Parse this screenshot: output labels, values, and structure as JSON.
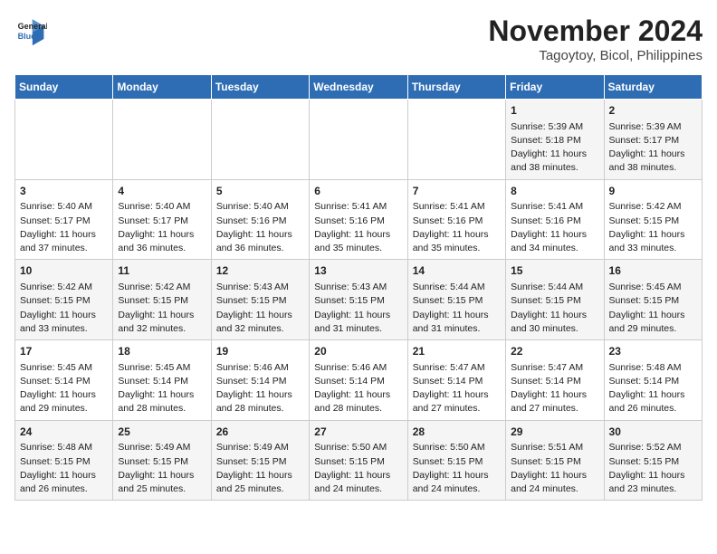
{
  "header": {
    "logo_line1": "General",
    "logo_line2": "Blue",
    "title": "November 2024",
    "subtitle": "Tagoytoy, Bicol, Philippines"
  },
  "days_of_week": [
    "Sunday",
    "Monday",
    "Tuesday",
    "Wednesday",
    "Thursday",
    "Friday",
    "Saturday"
  ],
  "weeks": [
    [
      {
        "day": "",
        "info": ""
      },
      {
        "day": "",
        "info": ""
      },
      {
        "day": "",
        "info": ""
      },
      {
        "day": "",
        "info": ""
      },
      {
        "day": "",
        "info": ""
      },
      {
        "day": "1",
        "info": "Sunrise: 5:39 AM\nSunset: 5:18 PM\nDaylight: 11 hours and 38 minutes."
      },
      {
        "day": "2",
        "info": "Sunrise: 5:39 AM\nSunset: 5:17 PM\nDaylight: 11 hours and 38 minutes."
      }
    ],
    [
      {
        "day": "3",
        "info": "Sunrise: 5:40 AM\nSunset: 5:17 PM\nDaylight: 11 hours and 37 minutes."
      },
      {
        "day": "4",
        "info": "Sunrise: 5:40 AM\nSunset: 5:17 PM\nDaylight: 11 hours and 36 minutes."
      },
      {
        "day": "5",
        "info": "Sunrise: 5:40 AM\nSunset: 5:16 PM\nDaylight: 11 hours and 36 minutes."
      },
      {
        "day": "6",
        "info": "Sunrise: 5:41 AM\nSunset: 5:16 PM\nDaylight: 11 hours and 35 minutes."
      },
      {
        "day": "7",
        "info": "Sunrise: 5:41 AM\nSunset: 5:16 PM\nDaylight: 11 hours and 35 minutes."
      },
      {
        "day": "8",
        "info": "Sunrise: 5:41 AM\nSunset: 5:16 PM\nDaylight: 11 hours and 34 minutes."
      },
      {
        "day": "9",
        "info": "Sunrise: 5:42 AM\nSunset: 5:15 PM\nDaylight: 11 hours and 33 minutes."
      }
    ],
    [
      {
        "day": "10",
        "info": "Sunrise: 5:42 AM\nSunset: 5:15 PM\nDaylight: 11 hours and 33 minutes."
      },
      {
        "day": "11",
        "info": "Sunrise: 5:42 AM\nSunset: 5:15 PM\nDaylight: 11 hours and 32 minutes."
      },
      {
        "day": "12",
        "info": "Sunrise: 5:43 AM\nSunset: 5:15 PM\nDaylight: 11 hours and 32 minutes."
      },
      {
        "day": "13",
        "info": "Sunrise: 5:43 AM\nSunset: 5:15 PM\nDaylight: 11 hours and 31 minutes."
      },
      {
        "day": "14",
        "info": "Sunrise: 5:44 AM\nSunset: 5:15 PM\nDaylight: 11 hours and 31 minutes."
      },
      {
        "day": "15",
        "info": "Sunrise: 5:44 AM\nSunset: 5:15 PM\nDaylight: 11 hours and 30 minutes."
      },
      {
        "day": "16",
        "info": "Sunrise: 5:45 AM\nSunset: 5:15 PM\nDaylight: 11 hours and 29 minutes."
      }
    ],
    [
      {
        "day": "17",
        "info": "Sunrise: 5:45 AM\nSunset: 5:14 PM\nDaylight: 11 hours and 29 minutes."
      },
      {
        "day": "18",
        "info": "Sunrise: 5:45 AM\nSunset: 5:14 PM\nDaylight: 11 hours and 28 minutes."
      },
      {
        "day": "19",
        "info": "Sunrise: 5:46 AM\nSunset: 5:14 PM\nDaylight: 11 hours and 28 minutes."
      },
      {
        "day": "20",
        "info": "Sunrise: 5:46 AM\nSunset: 5:14 PM\nDaylight: 11 hours and 28 minutes."
      },
      {
        "day": "21",
        "info": "Sunrise: 5:47 AM\nSunset: 5:14 PM\nDaylight: 11 hours and 27 minutes."
      },
      {
        "day": "22",
        "info": "Sunrise: 5:47 AM\nSunset: 5:14 PM\nDaylight: 11 hours and 27 minutes."
      },
      {
        "day": "23",
        "info": "Sunrise: 5:48 AM\nSunset: 5:14 PM\nDaylight: 11 hours and 26 minutes."
      }
    ],
    [
      {
        "day": "24",
        "info": "Sunrise: 5:48 AM\nSunset: 5:15 PM\nDaylight: 11 hours and 26 minutes."
      },
      {
        "day": "25",
        "info": "Sunrise: 5:49 AM\nSunset: 5:15 PM\nDaylight: 11 hours and 25 minutes."
      },
      {
        "day": "26",
        "info": "Sunrise: 5:49 AM\nSunset: 5:15 PM\nDaylight: 11 hours and 25 minutes."
      },
      {
        "day": "27",
        "info": "Sunrise: 5:50 AM\nSunset: 5:15 PM\nDaylight: 11 hours and 24 minutes."
      },
      {
        "day": "28",
        "info": "Sunrise: 5:50 AM\nSunset: 5:15 PM\nDaylight: 11 hours and 24 minutes."
      },
      {
        "day": "29",
        "info": "Sunrise: 5:51 AM\nSunset: 5:15 PM\nDaylight: 11 hours and 24 minutes."
      },
      {
        "day": "30",
        "info": "Sunrise: 5:52 AM\nSunset: 5:15 PM\nDaylight: 11 hours and 23 minutes."
      }
    ]
  ]
}
